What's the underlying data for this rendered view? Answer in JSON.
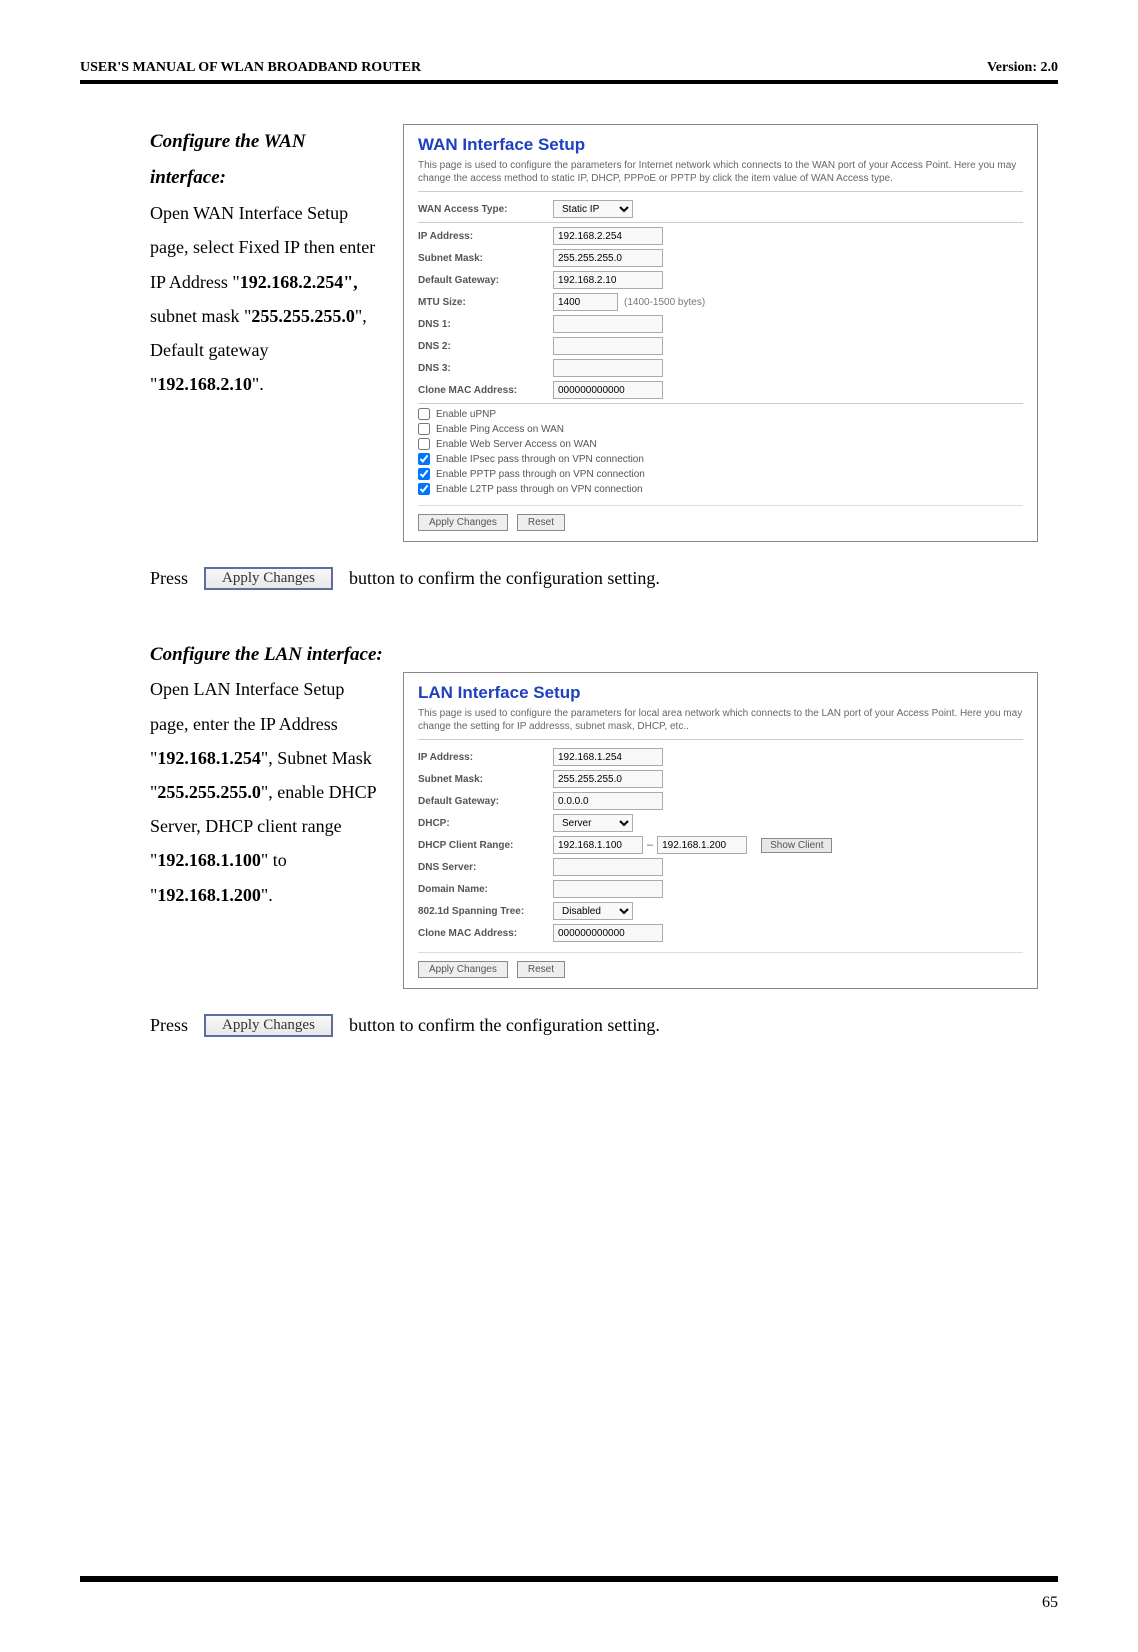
{
  "header": {
    "left": "USER'S MANUAL OF WLAN BROADBAND ROUTER",
    "right": "Version: 2.0"
  },
  "page_number": "65",
  "wan_section": {
    "title": "Configure the WAN interface:",
    "body": "Open WAN Interface Setup page, select Fixed IP then enter IP Address \"",
    "ip": "192.168.2.254\",",
    "body2": " subnet mask \"",
    "mask": "255.255.255.0",
    "body3": "\", Default gateway \"",
    "gw": "192.168.2.10",
    "body4": "\"."
  },
  "wan_panel": {
    "title": "WAN Interface Setup",
    "desc": "This page is used to configure the parameters for Internet network which connects to the WAN port of your Access Point. Here you may change the access method to static IP, DHCP, PPPoE or PPTP by click the item value of WAN Access type.",
    "rows": {
      "access_type_label": "WAN Access Type:",
      "access_type_value": "Static IP",
      "ip_label": "IP Address:",
      "ip_value": "192.168.2.254",
      "mask_label": "Subnet Mask:",
      "mask_value": "255.255.255.0",
      "gw_label": "Default Gateway:",
      "gw_value": "192.168.2.10",
      "mtu_label": "MTU Size:",
      "mtu_value": "1400",
      "mtu_note": "(1400-1500 bytes)",
      "dns1_label": "DNS 1:",
      "dns2_label": "DNS 2:",
      "dns3_label": "DNS 3:",
      "clone_label": "Clone MAC Address:",
      "clone_value": "000000000000"
    },
    "checks": {
      "upnp": "Enable uPNP",
      "ping": "Enable Ping Access on WAN",
      "webserver": "Enable Web Server Access on WAN",
      "ipsec": "Enable IPsec pass through on VPN connection",
      "pptp": "Enable PPTP pass through on VPN connection",
      "l2tp": "Enable L2TP pass through on VPN connection"
    },
    "apply": "Apply Changes",
    "reset": "Reset"
  },
  "press_line": {
    "press": "Press",
    "button_label": "Apply Changes",
    "suffix": "button to confirm the configuration setting."
  },
  "lan_section": {
    "title": "Configure the LAN interface:",
    "body": "Open LAN Interface Setup page, enter the IP Address \"",
    "ip": "192.168.1.254",
    "body2": "\", Subnet Mask \"",
    "mask": "255.255.255.0",
    "body3": "\", enable DHCP Server, DHCP client range \"",
    "start": "192.168.1.100",
    "body4": "\" to \"",
    "end": "192.168.1.200",
    "body5": "\"."
  },
  "lan_panel": {
    "title": "LAN Interface Setup",
    "desc": "This page is used to configure the parameters for local area network which connects to the LAN port of your Access Point. Here you may change the setting for IP addresss, subnet mask, DHCP, etc..",
    "rows": {
      "ip_label": "IP Address:",
      "ip_value": "192.168.1.254",
      "mask_label": "Subnet Mask:",
      "mask_value": "255.255.255.0",
      "gw_label": "Default Gateway:",
      "gw_value": "0.0.0.0",
      "dhcp_label": "DHCP:",
      "dhcp_value": "Server",
      "range_label": "DHCP Client Range:",
      "range_start": "192.168.1.100",
      "range_sep": "–",
      "range_end": "192.168.1.200",
      "show_client": "Show Client",
      "dns_label": "DNS Server:",
      "domain_label": "Domain Name:",
      "stp_label": "802.1d Spanning Tree:",
      "stp_value": "Disabled",
      "clone_label": "Clone MAC Address:",
      "clone_value": "000000000000"
    },
    "apply": "Apply Changes",
    "reset": "Reset"
  }
}
